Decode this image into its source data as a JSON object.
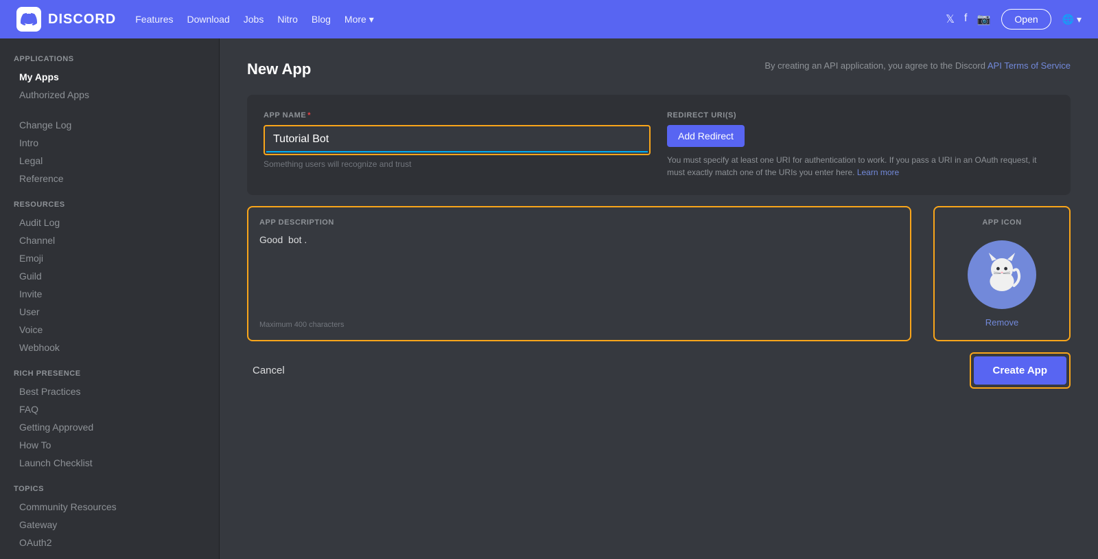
{
  "topnav": {
    "logo_text": "DISCORD",
    "nav_links": [
      "Features",
      "Download",
      "Jobs",
      "Nitro",
      "Blog",
      "More ▾"
    ],
    "open_btn": "Open",
    "lang_btn": "🌐"
  },
  "sidebar": {
    "applications_title": "APPLICATIONS",
    "apps_items": [
      {
        "label": "My Apps",
        "active": true
      },
      {
        "label": "Authorized Apps",
        "active": false
      }
    ],
    "other_links": [
      {
        "label": "Change Log"
      },
      {
        "label": "Intro"
      },
      {
        "label": "Legal"
      },
      {
        "label": "Reference"
      }
    ],
    "resources_title": "RESOURCES",
    "resources_links": [
      {
        "label": "Audit Log"
      },
      {
        "label": "Channel"
      },
      {
        "label": "Emoji"
      },
      {
        "label": "Guild"
      },
      {
        "label": "Invite"
      },
      {
        "label": "User"
      },
      {
        "label": "Voice"
      },
      {
        "label": "Webhook"
      }
    ],
    "rich_presence_title": "RICH PRESENCE",
    "rich_presence_links": [
      {
        "label": "Best Practices"
      },
      {
        "label": "FAQ"
      },
      {
        "label": "Getting Approved"
      },
      {
        "label": "How To"
      },
      {
        "label": "Launch Checklist"
      }
    ],
    "topics_title": "TOPICS",
    "topics_links": [
      {
        "label": "Community Resources"
      },
      {
        "label": "Gateway"
      },
      {
        "label": "OAuth2"
      }
    ]
  },
  "main": {
    "page_title": "New App",
    "page_subtitle": "By creating an API application, you agree to the Discord",
    "terms_link": "API Terms of Service",
    "app_name_label": "APP NAME",
    "app_name_required": "*",
    "app_name_value": "Tutorial Bot",
    "app_name_placeholder": "Something users will recognize and trust",
    "redirect_label": "REDIRECT URI(S)",
    "add_redirect_btn": "Add Redirect",
    "redirect_info": "You must specify at least one URI for authentication to work. If you pass a URI in an OAuth request, it must exactly match one of the URIs you enter here.",
    "learn_more_link": "Learn more",
    "app_description_label": "APP DESCRIPTION",
    "app_description_value": "Good  bot .",
    "app_description_hint": "Maximum 400 characters",
    "app_icon_label": "APP ICON",
    "remove_link": "Remove",
    "cancel_btn": "Cancel",
    "create_btn": "Create App"
  }
}
